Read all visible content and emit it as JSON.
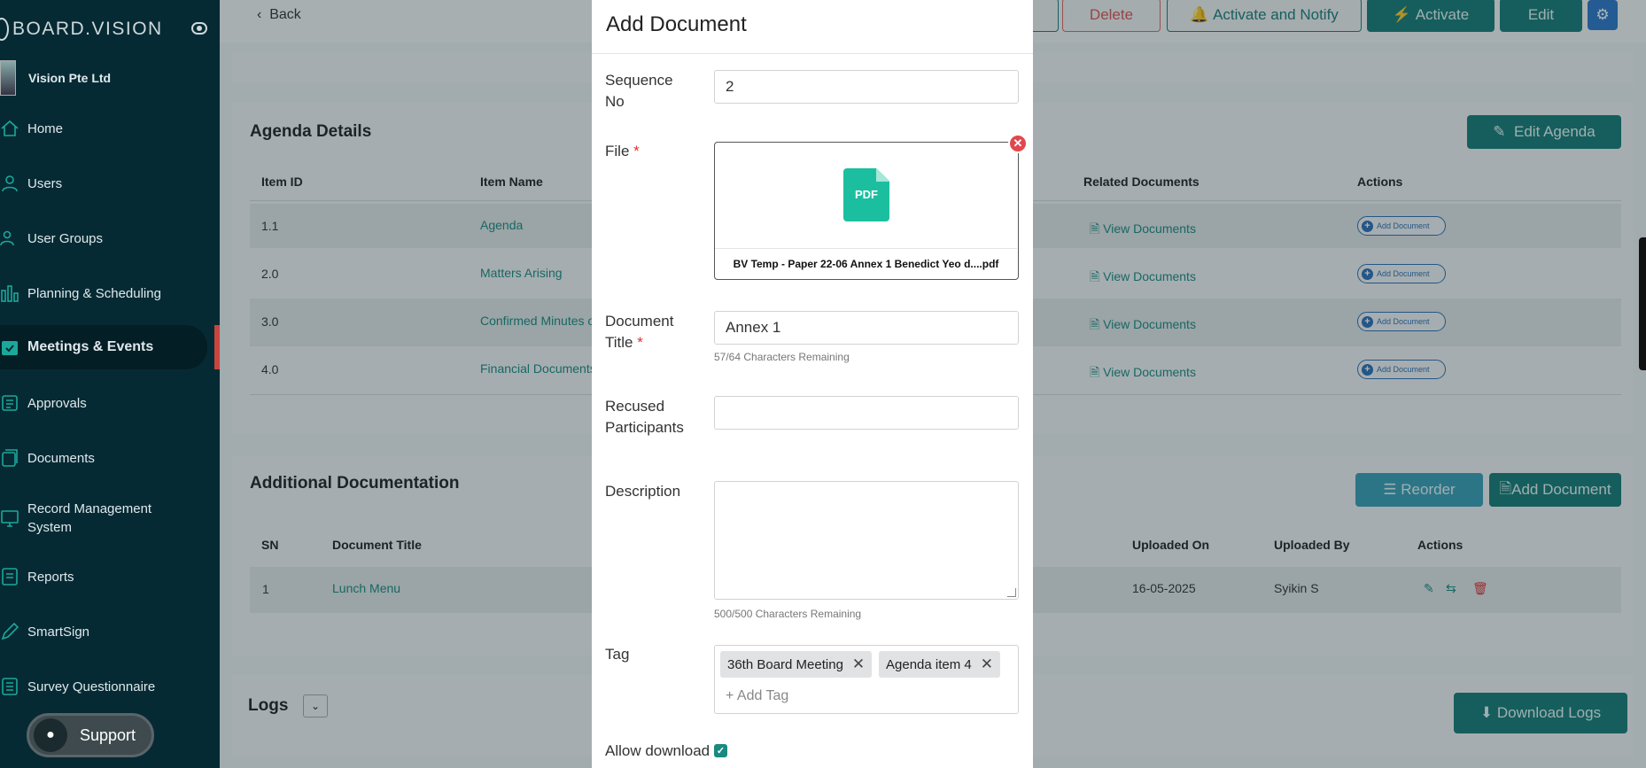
{
  "sidebar": {
    "brand": "BOARD.VISION",
    "company": "Vision Pte Ltd",
    "items": [
      {
        "label": "Home",
        "icon": "home-icon"
      },
      {
        "label": "Users",
        "icon": "user-icon"
      },
      {
        "label": "User Groups",
        "icon": "users-icon"
      },
      {
        "label": "Planning & Scheduling",
        "icon": "chart-icon"
      },
      {
        "label": "Meetings & Events",
        "icon": "calendar-icon",
        "active": true
      },
      {
        "label": "Approvals",
        "icon": "approval-icon"
      },
      {
        "label": "Documents",
        "icon": "documents-icon"
      },
      {
        "label": "Record Management System",
        "icon": "records-icon"
      },
      {
        "label": "Reports",
        "icon": "report-icon"
      },
      {
        "label": "SmartSign",
        "icon": "pen-icon"
      },
      {
        "label": "Survey Questionnaire",
        "icon": "survey-icon"
      }
    ],
    "support": "Support"
  },
  "topbar": {
    "back": "Back",
    "delete": "Delete",
    "activate_notify": "Activate and Notify",
    "activate": "Activate",
    "edit": "Edit"
  },
  "agenda": {
    "title": "Agenda Details",
    "edit_button": "Edit Agenda",
    "columns": [
      "Item ID",
      "Item Name",
      "Related Documents",
      "Actions"
    ],
    "rows": [
      {
        "id": "1.1",
        "name": "Agenda",
        "docs": "View Documents",
        "action": "Add Document"
      },
      {
        "id": "2.0",
        "name": "Matters Arising",
        "docs": "View Documents",
        "action": "Add Document"
      },
      {
        "id": "3.0",
        "name": "Confirmed Minutes o",
        "docs": "View Documents",
        "action": "Add Document"
      },
      {
        "id": "4.0",
        "name": "Financial Documents",
        "docs": "View Documents",
        "action": "Add Document"
      }
    ]
  },
  "additional": {
    "title": "Additional Documentation",
    "reorder": "Reorder",
    "add_document": "Add Document",
    "columns": [
      "SN",
      "Document Title",
      "Uploaded On",
      "Uploaded By",
      "Actions"
    ],
    "rows": [
      {
        "sn": "1",
        "title": "Lunch Menu",
        "uploaded_on": "16-05-2025",
        "uploaded_by": "Syikin S"
      }
    ]
  },
  "logs": {
    "title": "Logs",
    "download": "Download Logs"
  },
  "modal": {
    "title": "Add Document",
    "sequence_label_1": "Sequence",
    "sequence_label_2": "No",
    "sequence_value": "2",
    "file_label": "File",
    "file_icon_text": "PDF",
    "file_name": "BV Temp - Paper 22-06 Annex 1 Benedict Yeo d....pdf",
    "doc_title_label_1": "Document",
    "doc_title_label_2": "Title",
    "doc_title_value": "Annex 1",
    "doc_title_hint": "57/64 Characters Remaining",
    "recused_label_1": "Recused",
    "recused_label_2": "Participants",
    "recused_value": "",
    "description_label": "Description",
    "description_hint": "500/500 Characters Remaining",
    "tag_label": "Tag",
    "tags": [
      "36th Board Meeting",
      "Agenda item 4"
    ],
    "add_tag_placeholder": "+ Add Tag",
    "allow_download_label": "Allow download",
    "allow_download_checked": true,
    "required_mark": "*"
  },
  "colors": {
    "sidebar_bg": "#062a34",
    "accent_teal": "#167b77",
    "danger": "#e0484e"
  }
}
